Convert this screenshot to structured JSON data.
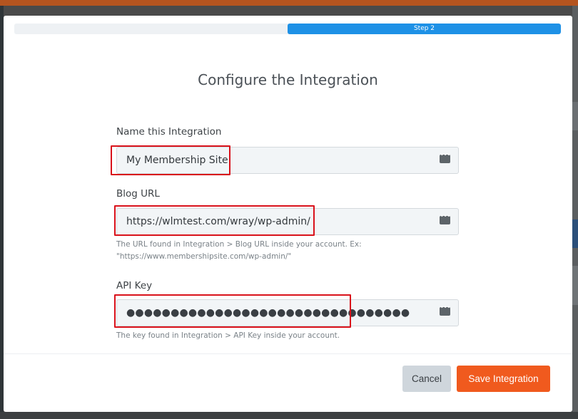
{
  "progress": {
    "step_label": "Step 2",
    "fraction": 0.5
  },
  "modal": {
    "title": "Configure the Integration"
  },
  "form": {
    "name": {
      "label": "Name this Integration",
      "value": "My Membership Site"
    },
    "blog_url": {
      "label": "Blog URL",
      "value": "https://wlmtest.com/wray/wp-admin/",
      "hint_line1": "The URL found in Integration > Blog URL inside your account. Ex:",
      "hint_line2": "\"https://www.membershipsite.com/wp-admin/\""
    },
    "api_key": {
      "label": "API Key",
      "value": "●●●●●●●●●●●●●●●●●●●●●●●●●●●●●●●●",
      "hint": "The key found in Integration > API Key inside your account."
    }
  },
  "buttons": {
    "cancel": "Cancel",
    "save": "Save Integration"
  },
  "colors": {
    "accent_blue": "#1e91e6",
    "save_orange": "#f05a1e",
    "highlight_red": "#d9121b"
  },
  "icons": {
    "field_menu": "ellipsis-icon"
  }
}
